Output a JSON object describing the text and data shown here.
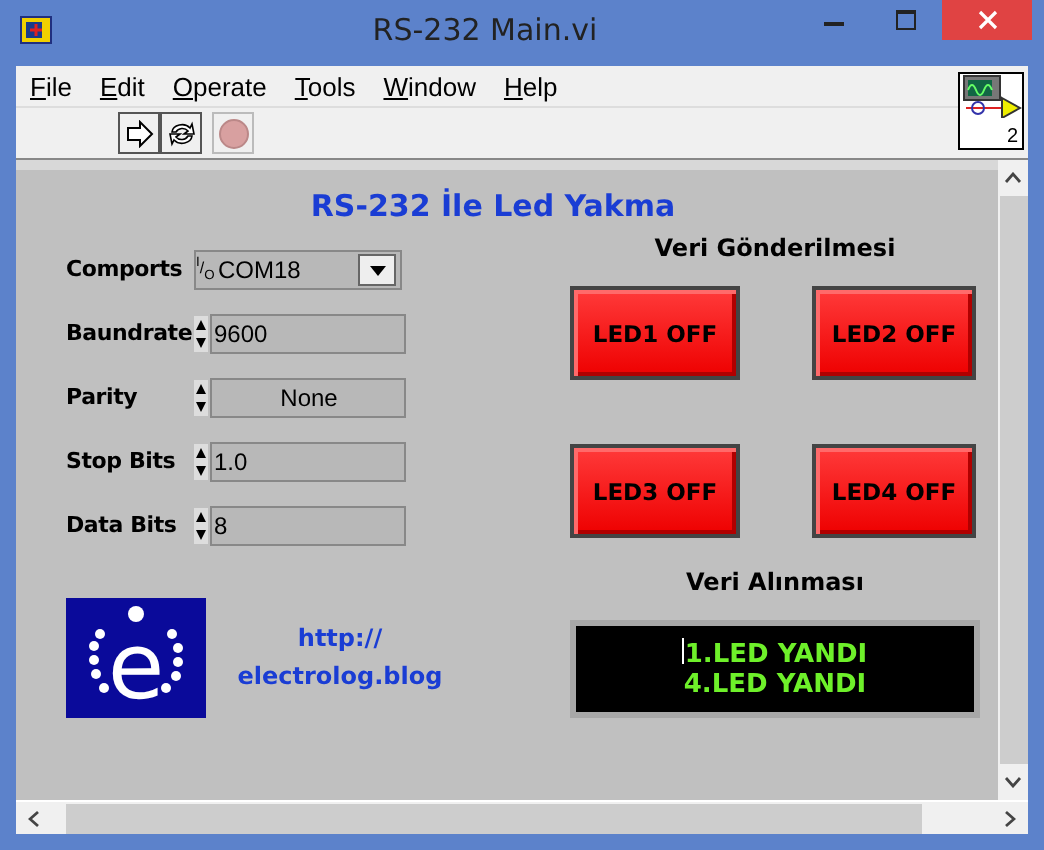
{
  "window": {
    "title": "RS-232 Main.vi"
  },
  "menu": [
    "File",
    "Edit",
    "Operate",
    "Tools",
    "Window",
    "Help"
  ],
  "vi_icon": {
    "number": "2"
  },
  "panel": {
    "title": "RS-232 İle Led Yakma",
    "fields": [
      {
        "label": "Comports",
        "kind": "ring",
        "io_label": "$^{I}$/$_{O}$",
        "value": "COM18"
      },
      {
        "label": "Baundrate",
        "kind": "numeric",
        "value": "9600"
      },
      {
        "label": "Parity",
        "kind": "enum",
        "value": "None"
      },
      {
        "label": "Stop Bits",
        "kind": "numeric",
        "value": "1.0"
      },
      {
        "label": "Data Bits",
        "kind": "numeric",
        "value": "8"
      }
    ],
    "logo_letter": "e",
    "link": "http:// electrolog.blog",
    "send_heading": "Veri Gönderilmesi",
    "led_buttons": [
      "LED1 OFF",
      "LED2 OFF",
      "LED3 OFF",
      "LED4 OFF"
    ],
    "receive_heading": "Veri Alınması",
    "display_lines": [
      "1.LED YANDI",
      "4.LED YANDI"
    ]
  }
}
